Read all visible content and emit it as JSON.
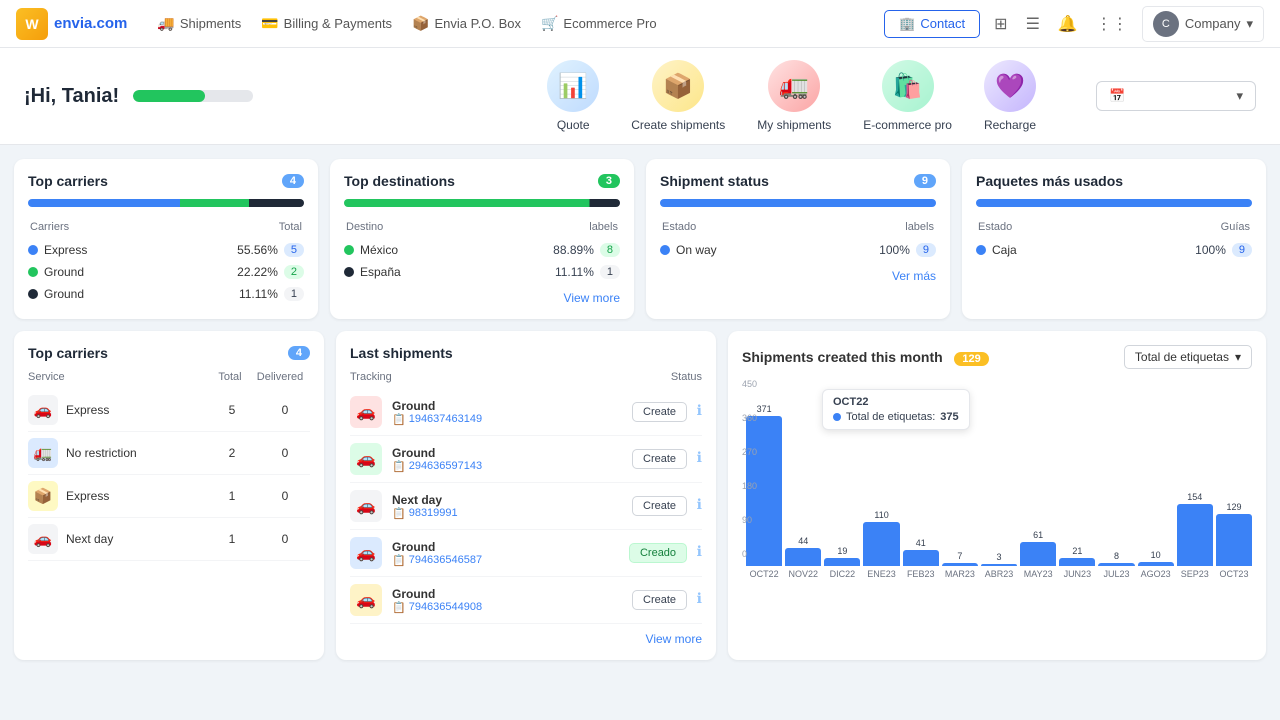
{
  "nav": {
    "logo": "envia.com",
    "items": [
      {
        "label": "Shipments",
        "icon": "🚚"
      },
      {
        "label": "Billing & Payments",
        "icon": "💳"
      },
      {
        "label": "Envia P.O. Box",
        "icon": "📦"
      },
      {
        "label": "Ecommerce Pro",
        "icon": "🛒"
      }
    ],
    "contact_label": "Contact",
    "company_label": "Company"
  },
  "hero": {
    "greeting": "¡Hi, Tania!",
    "progress_percent": 60,
    "quick_actions": [
      {
        "label": "Quote",
        "emoji": "📊"
      },
      {
        "label": "Create shipments",
        "emoji": "📦"
      },
      {
        "label": "My shipments",
        "emoji": "🚛"
      },
      {
        "label": "E-commerce pro",
        "emoji": "🛍️"
      },
      {
        "label": "Recharge",
        "emoji": "💜"
      }
    ],
    "date_placeholder": "📅"
  },
  "top_carriers": {
    "title": "Top carriers",
    "badge": "4",
    "col_left": "Carriers",
    "col_right": "Total",
    "carriers": [
      {
        "name": "Express",
        "pct": "55.56%",
        "dot": "blue",
        "count": "5"
      },
      {
        "name": "Ground",
        "pct": "22.22%",
        "dot": "green",
        "count": "2"
      },
      {
        "name": "Ground",
        "pct": "11.11%",
        "dot": "dark",
        "count": "1"
      }
    ],
    "bars": [
      {
        "color": "blue",
        "width": "55"
      },
      {
        "color": "green",
        "width": "25"
      },
      {
        "color": "dark",
        "width": "20"
      }
    ]
  },
  "top_destinations": {
    "title": "Top destinations",
    "badge": "3",
    "col_left": "Destino",
    "col_right": "labels",
    "destinations": [
      {
        "name": "México",
        "pct": "88.89%",
        "dot": "green",
        "count": "8"
      },
      {
        "name": "España",
        "pct": "11.11%",
        "dot": "dark",
        "count": "1"
      }
    ],
    "view_more": "View more"
  },
  "shipment_status": {
    "title": "Shipment status",
    "badge": "9",
    "col_left": "Estado",
    "col_right": "labels",
    "statuses": [
      {
        "name": "On way",
        "pct": "100%",
        "dot": "blue",
        "count": "9"
      }
    ],
    "ver_mas": "Ver más"
  },
  "paquetes": {
    "title": "Paquetes más usados",
    "col_left": "Estado",
    "col_right": "Guías",
    "items": [
      {
        "name": "Caja",
        "pct": "100%",
        "dot": "blue",
        "count": "9"
      }
    ]
  },
  "top_carriers2": {
    "title": "Top carriers",
    "badge": "4",
    "col_service": "Service",
    "col_total": "Total",
    "col_delivered": "Delivered",
    "services": [
      {
        "name": "Express",
        "icon": "🚗",
        "style": "gray",
        "total": "5",
        "delivered": "0"
      },
      {
        "name": "No restriction",
        "icon": "🚛",
        "style": "blue",
        "total": "2",
        "delivered": "0"
      },
      {
        "name": "Express",
        "icon": "📦",
        "style": "yellow",
        "total": "1",
        "delivered": "0"
      },
      {
        "name": "Next day",
        "icon": "🚗",
        "style": "gray",
        "total": "1",
        "delivered": "0"
      }
    ]
  },
  "last_shipments": {
    "title": "Last shipments",
    "col_tracking": "Tracking",
    "col_status": "Status",
    "shipments": [
      {
        "carrier": "Ground",
        "tracking": "194637463149",
        "icon": "🚗",
        "style": "red",
        "status": "Create"
      },
      {
        "carrier": "Ground",
        "tracking": "294636597143",
        "icon": "🚗",
        "style": "green",
        "status": "Create"
      },
      {
        "carrier": "Next day",
        "tracking": "98319991",
        "icon": "🚗",
        "style": "gray",
        "status": "Create"
      },
      {
        "carrier": "Ground",
        "tracking": "794636546587",
        "icon": "🚗",
        "style": "blue",
        "status": "Creado"
      },
      {
        "carrier": "Ground",
        "tracking": "794636544908",
        "icon": "🚗",
        "style": "brown",
        "status": "Create"
      }
    ],
    "view_more": "View more"
  },
  "chart": {
    "title": "Shipments created this month",
    "badge": "129",
    "select_label": "Total de etiquetas",
    "tooltip": {
      "month": "OCT22",
      "label": "Total de etiquetas:",
      "value": "375"
    },
    "y_labels": [
      "450",
      "360",
      "270",
      "180",
      "90",
      "0"
    ],
    "bars": [
      {
        "month": "OCT22",
        "value": 375,
        "label": "371"
      },
      {
        "month": "NOV22",
        "value": 44,
        "label": "44"
      },
      {
        "month": "DIC22",
        "value": 19,
        "label": "19"
      },
      {
        "month": "ENE23",
        "value": 110,
        "label": "110"
      },
      {
        "month": "FEB23",
        "value": 41,
        "label": "41"
      },
      {
        "month": "MAR23",
        "value": 7,
        "label": "7"
      },
      {
        "month": "ABR23",
        "value": 3,
        "label": "3"
      },
      {
        "month": "MAY23",
        "value": 61,
        "label": "61"
      },
      {
        "month": "JUN23",
        "value": 21,
        "label": "21"
      },
      {
        "month": "JUL23",
        "value": 8,
        "label": "8"
      },
      {
        "month": "AGO23",
        "value": 10,
        "label": "10"
      },
      {
        "month": "SEP23",
        "value": 154,
        "label": "154"
      },
      {
        "month": "OCT23",
        "value": 129,
        "label": "129"
      }
    ],
    "max_value": 450
  }
}
